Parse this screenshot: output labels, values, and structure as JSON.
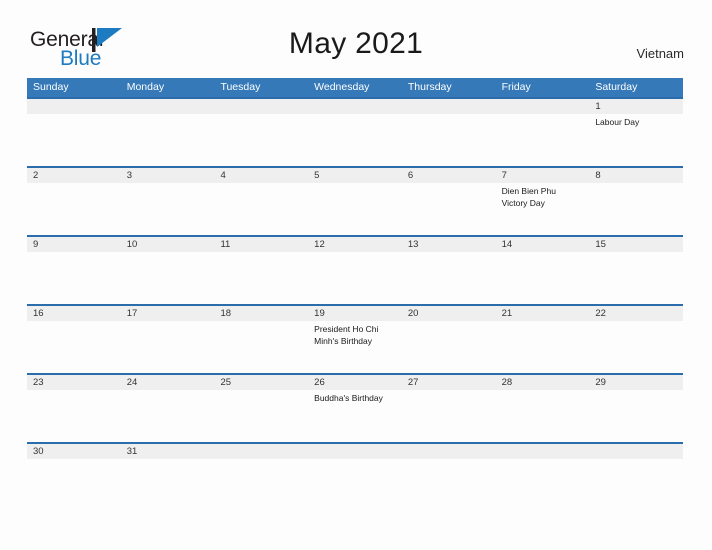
{
  "brand": {
    "name_part1": "General",
    "name_part2": "Blue",
    "flag_color": "#1d7bc1"
  },
  "header": {
    "title": "May 2021",
    "country": "Vietnam"
  },
  "theme": {
    "header_blue": "#3579b8",
    "rule_blue": "#2b6cad",
    "band_grey": "#efefef",
    "page_background": "#fdfdfd"
  },
  "weekdays": [
    "Sunday",
    "Monday",
    "Tuesday",
    "Wednesday",
    "Thursday",
    "Friday",
    "Saturday"
  ],
  "weeks": [
    {
      "days": [
        {
          "number": "",
          "event": ""
        },
        {
          "number": "",
          "event": ""
        },
        {
          "number": "",
          "event": ""
        },
        {
          "number": "",
          "event": ""
        },
        {
          "number": "",
          "event": ""
        },
        {
          "number": "",
          "event": ""
        },
        {
          "number": "1",
          "event": "Labour Day"
        }
      ]
    },
    {
      "days": [
        {
          "number": "2",
          "event": ""
        },
        {
          "number": "3",
          "event": ""
        },
        {
          "number": "4",
          "event": ""
        },
        {
          "number": "5",
          "event": ""
        },
        {
          "number": "6",
          "event": ""
        },
        {
          "number": "7",
          "event": "Dien Bien Phu\nVictory Day"
        },
        {
          "number": "8",
          "event": ""
        }
      ]
    },
    {
      "days": [
        {
          "number": "9",
          "event": ""
        },
        {
          "number": "10",
          "event": ""
        },
        {
          "number": "11",
          "event": ""
        },
        {
          "number": "12",
          "event": ""
        },
        {
          "number": "13",
          "event": ""
        },
        {
          "number": "14",
          "event": ""
        },
        {
          "number": "15",
          "event": ""
        }
      ]
    },
    {
      "days": [
        {
          "number": "16",
          "event": ""
        },
        {
          "number": "17",
          "event": ""
        },
        {
          "number": "18",
          "event": ""
        },
        {
          "number": "19",
          "event": "President Ho Chi\nMinh's Birthday"
        },
        {
          "number": "20",
          "event": ""
        },
        {
          "number": "21",
          "event": ""
        },
        {
          "number": "22",
          "event": ""
        }
      ]
    },
    {
      "days": [
        {
          "number": "23",
          "event": ""
        },
        {
          "number": "24",
          "event": ""
        },
        {
          "number": "25",
          "event": ""
        },
        {
          "number": "26",
          "event": "Buddha's Birthday"
        },
        {
          "number": "27",
          "event": ""
        },
        {
          "number": "28",
          "event": ""
        },
        {
          "number": "29",
          "event": ""
        }
      ]
    },
    {
      "days": [
        {
          "number": "30",
          "event": ""
        },
        {
          "number": "31",
          "event": ""
        },
        {
          "number": "",
          "event": ""
        },
        {
          "number": "",
          "event": ""
        },
        {
          "number": "",
          "event": ""
        },
        {
          "number": "",
          "event": ""
        },
        {
          "number": "",
          "event": ""
        }
      ]
    }
  ]
}
